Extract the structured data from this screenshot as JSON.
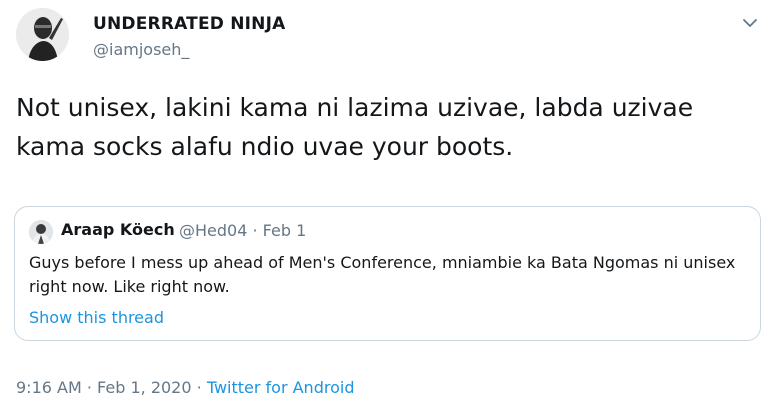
{
  "author": {
    "display_name": "UNDERRATED NINJA",
    "handle": "@iamjoseh_"
  },
  "tweet": {
    "text": "Not unisex, lakini kama ni lazima uzivae, labda uzivae kama socks alafu ndio uvae your boots."
  },
  "quoted_tweet": {
    "display_name": "Araap Köech",
    "handle": "@Hed04",
    "separator": "·",
    "date": "Feb 1",
    "text": "Guys before I mess up ahead of Men's Conference, mniambie ka Bata Ngomas ni unisex right now. Like right now.",
    "thread_link": "Show this thread"
  },
  "footer": {
    "time": "9:16 AM",
    "separator_1": "·",
    "date": "Feb 1, 2020",
    "separator_2": "·",
    "source": "Twitter for Android"
  },
  "icons": {
    "caret": "chevron-down-icon"
  },
  "colors": {
    "link": "#1b95e0",
    "secondary_text": "#657786",
    "border": "#ccd6dd"
  }
}
